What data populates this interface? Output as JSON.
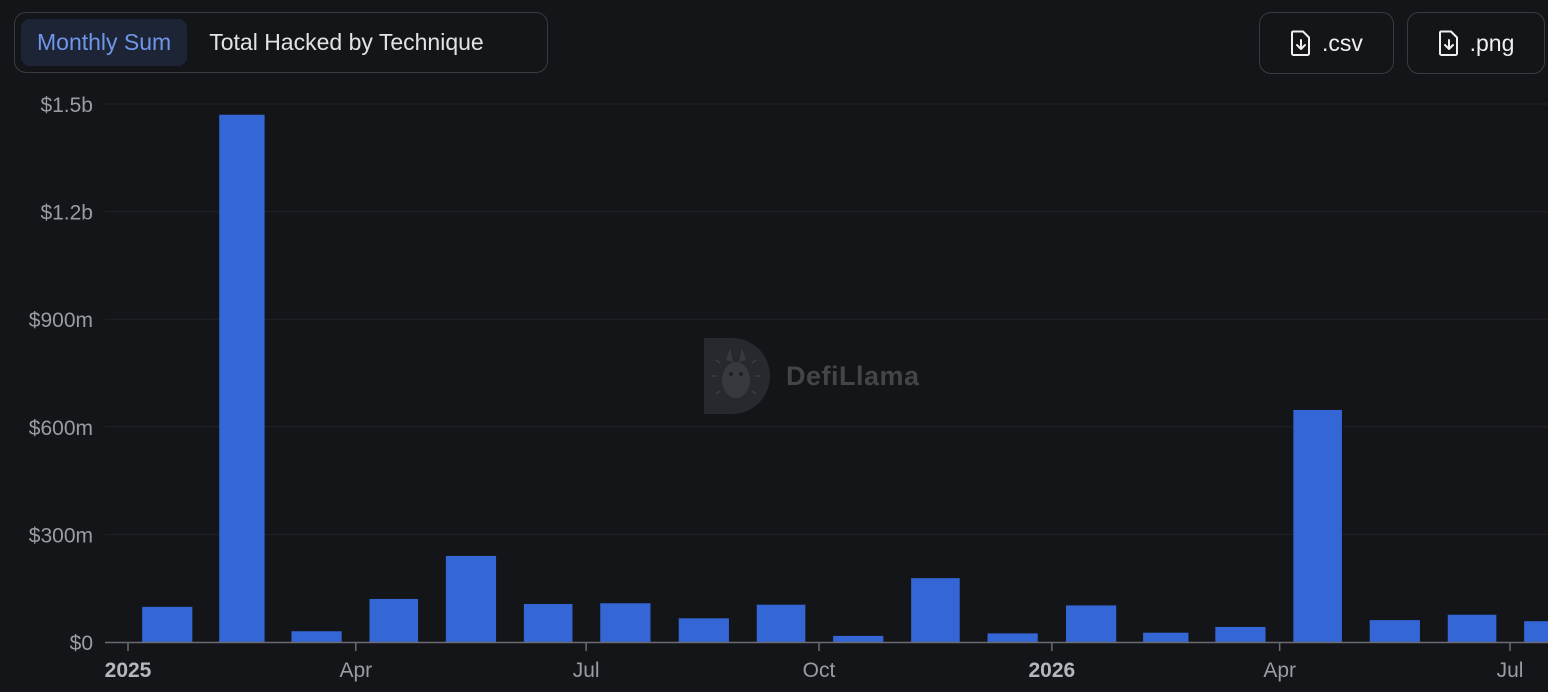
{
  "toggles": {
    "monthly_sum": "Monthly Sum",
    "total_by_technique": "Total Hacked by Technique"
  },
  "downloads": {
    "csv": ".csv",
    "png": ".png"
  },
  "watermark": {
    "text": "DefiLlama"
  },
  "colors": {
    "bar": "#3466d6",
    "background": "#141518",
    "grid": "#222328",
    "axis": "#6b6d72",
    "tick_label": "#9a9ca1",
    "year_label": "#b5b7bc"
  },
  "chart_data": {
    "type": "bar",
    "x": [
      "2025-01",
      "2025-02",
      "2025-03",
      "2025-04",
      "2025-05",
      "2025-06",
      "2025-07",
      "2025-08",
      "2025-09",
      "2025-10",
      "2025-11",
      "2025-12",
      "2026-01",
      "2026-02",
      "2026-03",
      "2026-04",
      "2026-05",
      "2026-06",
      "2026-07"
    ],
    "values": [
      98000000,
      1470000000,
      30000000,
      120000000,
      240000000,
      106000000,
      108000000,
      66000000,
      104000000,
      17000000,
      178000000,
      24000000,
      102000000,
      26000000,
      42000000,
      647000000,
      61000000,
      76000000,
      58000000
    ],
    "ylim": [
      0,
      1500000000
    ],
    "y_ticks": [
      {
        "value": 0,
        "label": "$0"
      },
      {
        "value": 300000000,
        "label": "$300m"
      },
      {
        "value": 600000000,
        "label": "$600m"
      },
      {
        "value": 900000000,
        "label": "$900m"
      },
      {
        "value": 1200000000,
        "label": "$1.2b"
      },
      {
        "value": 1500000000,
        "label": "$1.5b"
      }
    ],
    "x_ticks": [
      {
        "date": "2025-01-01",
        "label": "2025",
        "bold": true
      },
      {
        "date": "2025-04-01",
        "label": "Apr",
        "bold": false
      },
      {
        "date": "2025-07-01",
        "label": "Jul",
        "bold": false
      },
      {
        "date": "2025-10-01",
        "label": "Oct",
        "bold": false
      },
      {
        "date": "2026-01-01",
        "label": "2026",
        "bold": true
      },
      {
        "date": "2026-04-01",
        "label": "Apr",
        "bold": false
      },
      {
        "date": "2026-07-01",
        "label": "Jul",
        "bold": false
      }
    ],
    "grid": true
  }
}
